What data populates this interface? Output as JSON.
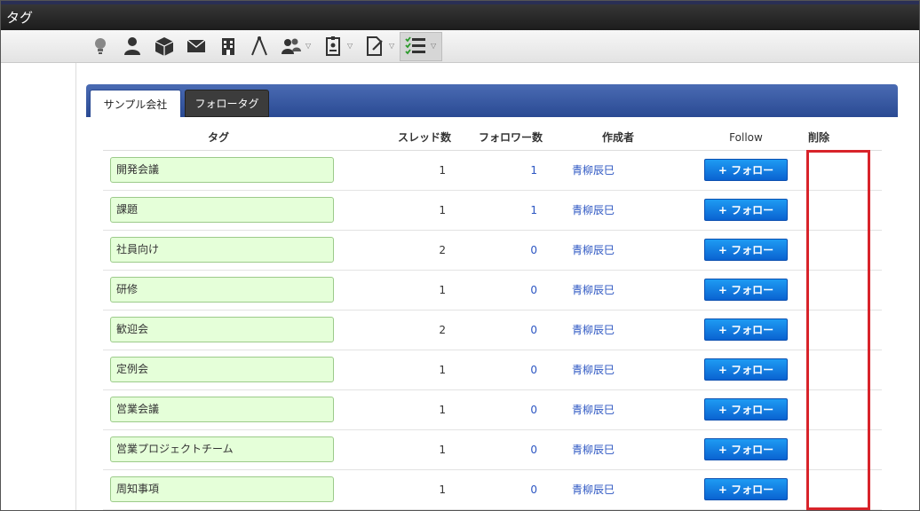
{
  "window": {
    "title": "タグ"
  },
  "toolbar": {
    "icons": [
      {
        "name": "lightbulb-icon"
      },
      {
        "name": "user-icon"
      },
      {
        "name": "package-icon"
      },
      {
        "name": "mail-icon"
      },
      {
        "name": "building-icon"
      },
      {
        "name": "compass-icon"
      },
      {
        "name": "group-icon"
      },
      {
        "name": "badge-icon"
      },
      {
        "name": "document-edit-icon"
      },
      {
        "name": "checklist-icon"
      }
    ]
  },
  "tabs": [
    {
      "label": "サンプル会社",
      "active": true
    },
    {
      "label": "フォロータグ",
      "active": false
    }
  ],
  "table": {
    "headers": {
      "tag": "タグ",
      "threads": "スレッド数",
      "followers": "フォロワー数",
      "creator": "作成者",
      "follow": "Follow",
      "delete": "削除"
    },
    "rows": [
      {
        "tag": "開発会議",
        "threads": "1",
        "followers": "1",
        "creator": "青柳辰巳",
        "follow_label": "+ フォロー"
      },
      {
        "tag": "課題",
        "threads": "1",
        "followers": "1",
        "creator": "青柳辰巳",
        "follow_label": "+ フォロー"
      },
      {
        "tag": "社員向け",
        "threads": "2",
        "followers": "0",
        "creator": "青柳辰巳",
        "follow_label": "+ フォロー"
      },
      {
        "tag": "研修",
        "threads": "1",
        "followers": "0",
        "creator": "青柳辰巳",
        "follow_label": "+ フォロー"
      },
      {
        "tag": "歓迎会",
        "threads": "2",
        "followers": "0",
        "creator": "青柳辰巳",
        "follow_label": "+ フォロー"
      },
      {
        "tag": "定例会",
        "threads": "1",
        "followers": "0",
        "creator": "青柳辰巳",
        "follow_label": "+ フォロー"
      },
      {
        "tag": "営業会議",
        "threads": "1",
        "followers": "0",
        "creator": "青柳辰巳",
        "follow_label": "+ フォロー"
      },
      {
        "tag": "営業プロジェクトチーム",
        "threads": "1",
        "followers": "0",
        "creator": "青柳辰巳",
        "follow_label": "+ フォロー"
      },
      {
        "tag": "周知事項",
        "threads": "1",
        "followers": "0",
        "creator": "青柳辰巳",
        "follow_label": "+ フォロー"
      }
    ]
  },
  "colors": {
    "highlight": "#d8232a",
    "link": "#2b55c2",
    "tag_bg": "#e5ffd9",
    "tabbar": "#2a4a93",
    "follow_button": "#0a63d1"
  }
}
